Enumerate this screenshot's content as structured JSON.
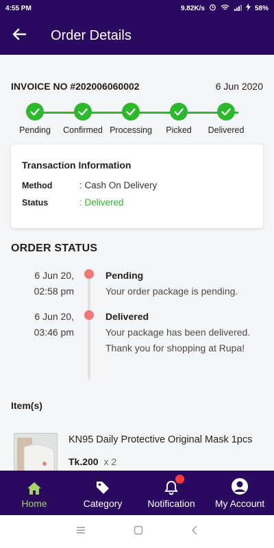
{
  "status_bar": {
    "time": "4:55 PM",
    "network_speed": "9.82K/s",
    "battery": "58%"
  },
  "app_bar": {
    "title": "Order Details",
    "back_icon": "arrow-left-icon"
  },
  "invoice": {
    "number": "INVOICE NO #202006060002",
    "date": "6 Jun 2020"
  },
  "progress_steps": [
    {
      "label": "Pending",
      "done": true
    },
    {
      "label": "Confirmed",
      "done": true
    },
    {
      "label": "Processing",
      "done": true
    },
    {
      "label": "Picked",
      "done": true
    },
    {
      "label": "Delivered",
      "done": true
    }
  ],
  "transaction": {
    "title": "Transaction Information",
    "method_key": "Method",
    "method_value": ": Cash On Delivery",
    "status_key": "Status",
    "status_value": ": Delivered"
  },
  "order_status": {
    "title": "ORDER STATUS",
    "entries": [
      {
        "date": "6 Jun 20,",
        "time": "02:58 pm",
        "title": "Pending",
        "desc": "Your order package is pending."
      },
      {
        "date": "6 Jun 20,",
        "time": "03:46 pm",
        "title": "Delivered",
        "desc": "Your package has been delivered. Thank you for shopping at Rupa!"
      }
    ]
  },
  "items": {
    "title": "Item(s)",
    "list": [
      {
        "name": "KN95 Daily Protective Original Mask 1pcs",
        "price": "Tk.200",
        "qty": "x 2"
      }
    ]
  },
  "bottom_nav": [
    {
      "label": "Home",
      "icon": "home-icon",
      "active": true
    },
    {
      "label": "Category",
      "icon": "tag-icon",
      "active": false
    },
    {
      "label": "Notification",
      "icon": "bell-icon",
      "active": false,
      "badge": true
    },
    {
      "label": "My Account",
      "icon": "account-icon",
      "active": false
    }
  ],
  "colors": {
    "primary": "#2a0a5e",
    "success": "#2db82d",
    "timeline_dot": "#f07777",
    "nav_active": "#a8d36b",
    "badge": "#ff3b3b"
  }
}
